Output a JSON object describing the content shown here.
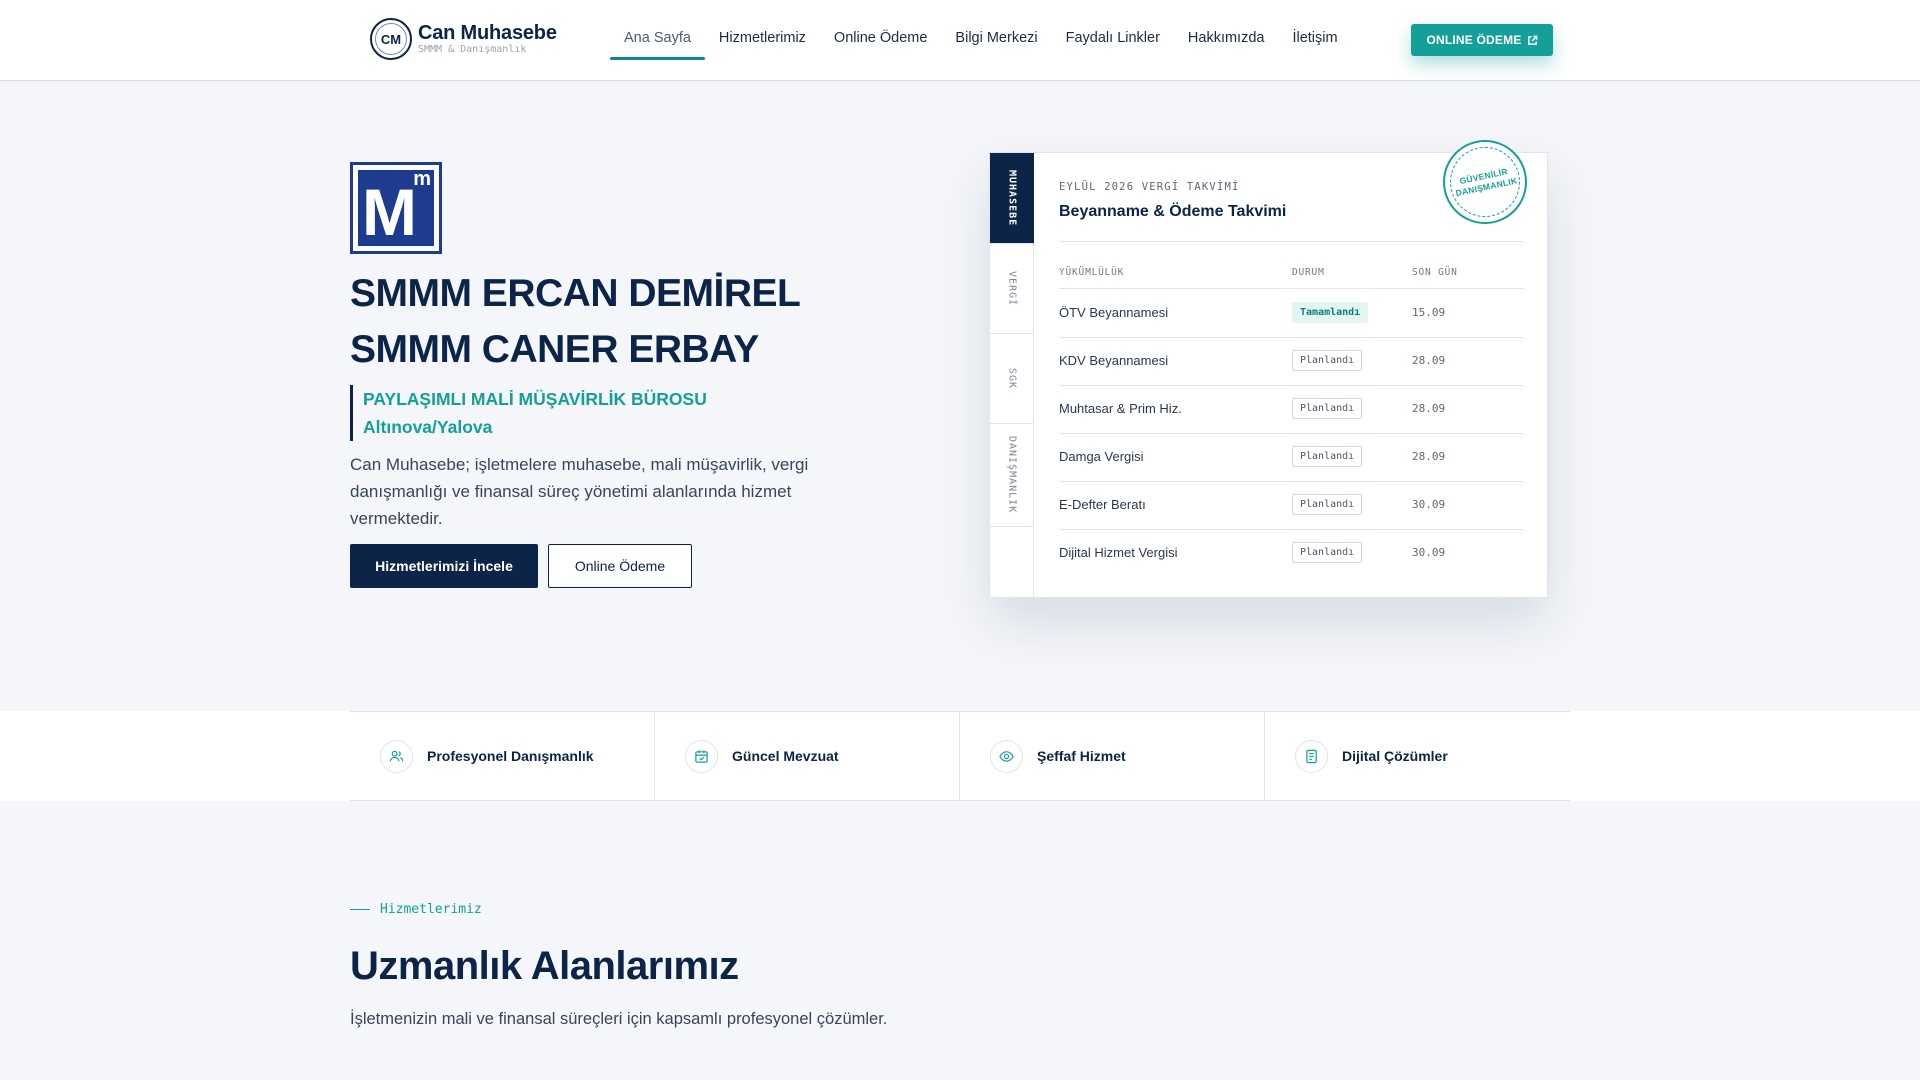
{
  "header": {
    "logo_mark": "CM",
    "logo_title": "Can Muhasebe",
    "logo_sub": "SMMM & Danışmanlık",
    "nav": [
      "Ana Sayfa",
      "Hizmetlerimiz",
      "Online Ödeme",
      "Bilgi Merkezi",
      "Faydalı Linkler",
      "Hakkımızda",
      "İletişim"
    ],
    "active_nav": "Ana Sayfa",
    "cta_label": "ONLINE ÖDEME"
  },
  "hero": {
    "logo_big": "M",
    "logo_small": "m",
    "title_line1": "SMMM ERCAN DEMİREL",
    "title_line2": "SMMM CANER ERBAY",
    "sub_line1": "PAYLAŞIMLI MALİ MÜŞAVİRLİK BÜROSU",
    "sub_line2": "Altınova/Yalova",
    "description": "Can Muhasebe; işletmelere muhasebe, mali müşavirlik, vergi danışmanlığı ve finansal süreç yönetimi alanlarında hizmet vermektedir.",
    "primary_button": "Hizmetlerimizi İncele",
    "secondary_button": "Online Ödeme"
  },
  "calendar": {
    "side_tabs": [
      "MUHASEBE",
      "VERGİ",
      "SGK",
      "DANIŞMANLIK"
    ],
    "active_tab": "MUHASEBE",
    "kicker": "EYLÜL 2026 VERGİ TAKVİMİ",
    "title": "Beyanname & Ödeme Takvimi",
    "stamp": "GÜVENİLİR DANIŞMANLIK",
    "columns": [
      "YÜKÜMLÜLÜK",
      "DURUM",
      "SON GÜN"
    ],
    "rows": [
      {
        "name": "ÖTV Beyannamesi",
        "status": "Tamamlandı",
        "date": "15.09",
        "done": true
      },
      {
        "name": "KDV Beyannamesi",
        "status": "Planlandı",
        "date": "28.09",
        "done": false
      },
      {
        "name": "Muhtasar & Prim Hiz.",
        "status": "Planlandı",
        "date": "28.09",
        "done": false
      },
      {
        "name": "Damga Vergisi",
        "status": "Planlandı",
        "date": "28.09",
        "done": false
      },
      {
        "name": "E-Defter Beratı",
        "status": "Planlandı",
        "date": "30.09",
        "done": false
      },
      {
        "name": "Dijital Hizmet Vergisi",
        "status": "Planlandı",
        "date": "30.09",
        "done": false
      }
    ]
  },
  "features": [
    {
      "label": "Profesyonel Danışmanlık",
      "icon": "users-icon"
    },
    {
      "label": "Güncel Mevzuat",
      "icon": "calendar-check-icon"
    },
    {
      "label": "Şeffaf Hizmet",
      "icon": "eye-icon"
    },
    {
      "label": "Dijital Çözümler",
      "icon": "document-icon"
    }
  ],
  "services": {
    "kicker": "Hizmetlerimiz",
    "title": "Uzmanlık Alanlarımız",
    "description": "İşletmenizin mali ve finansal süreçleri için kapsamlı profesyonel çözümler."
  },
  "colors": {
    "navy": "#0b2447",
    "teal": "#14a098",
    "background": "#f4f6f9"
  }
}
